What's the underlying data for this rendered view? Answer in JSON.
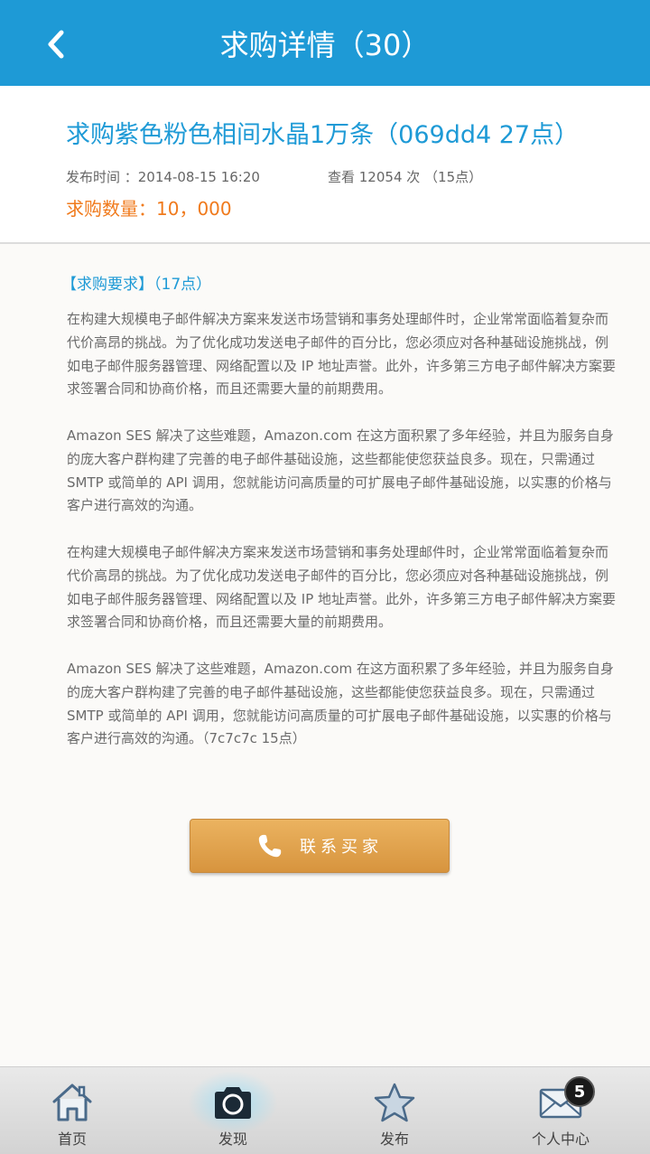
{
  "header": {
    "title": "求购详情（30）"
  },
  "summary": {
    "title": "求购紫色粉色相间水晶1万条（069dd4  27点）",
    "publish_time": "发布时间 ：2014-08-15  16:20",
    "views": "查看 12054 次 （15点）",
    "quantity": "求购数量：10，000"
  },
  "requirements": {
    "heading": "【求购要求】（17点）",
    "paragraphs": [
      "在构建大规模电子邮件解决方案来发送市场营销和事务处理邮件时，企业常常面临着复杂而代价高昂的挑战。为了优化成功发送电子邮件的百分比，您必须应对各种基础设施挑战，例如电子邮件服务器管理、网络配置以及 IP 地址声誉。此外，许多第三方电子邮件解决方案要求签署合同和协商价格，而且还需要大量的前期费用。",
      "Amazon SES 解决了这些难题，Amazon.com 在这方面积累了多年经验，并且为服务自身的庞大客户群构建了完善的电子邮件基础设施，这些都能使您获益良多。现在，只需通过 SMTP 或简单的 API 调用，您就能访问高质量的可扩展电子邮件基础设施，以实惠的价格与客户进行高效的沟通。",
      "在构建大规模电子邮件解决方案来发送市场营销和事务处理邮件时，企业常常面临着复杂而代价高昂的挑战。为了优化成功发送电子邮件的百分比，您必须应对各种基础设施挑战，例如电子邮件服务器管理、网络配置以及 IP 地址声誉。此外，许多第三方电子邮件解决方案要求签署合同和协商价格，而且还需要大量的前期费用。",
      "Amazon SES 解决了这些难题，Amazon.com 在这方面积累了多年经验，并且为服务自身的庞大客户群构建了完善的电子邮件基础设施，这些都能使您获益良多。现在，只需通过 SMTP 或简单的 API 调用，您就能访问高质量的可扩展电子邮件基础设施，以实惠的价格与客户进行高效的沟通。（7c7c7c 15点）"
    ]
  },
  "contact_button": {
    "label": "联系买家",
    "icon": "phone-icon"
  },
  "tabbar": {
    "tabs": [
      {
        "label": "首页",
        "icon": "home-icon"
      },
      {
        "label": "发现",
        "icon": "camera-icon",
        "active": true
      },
      {
        "label": "发布",
        "icon": "star-icon"
      },
      {
        "label": "个人中心",
        "icon": "mail-icon"
      }
    ],
    "badge_count": "5"
  },
  "colors": {
    "header": "#1e9ad6",
    "accent_orange": "#f07a1c",
    "button": "#e0a24c"
  }
}
